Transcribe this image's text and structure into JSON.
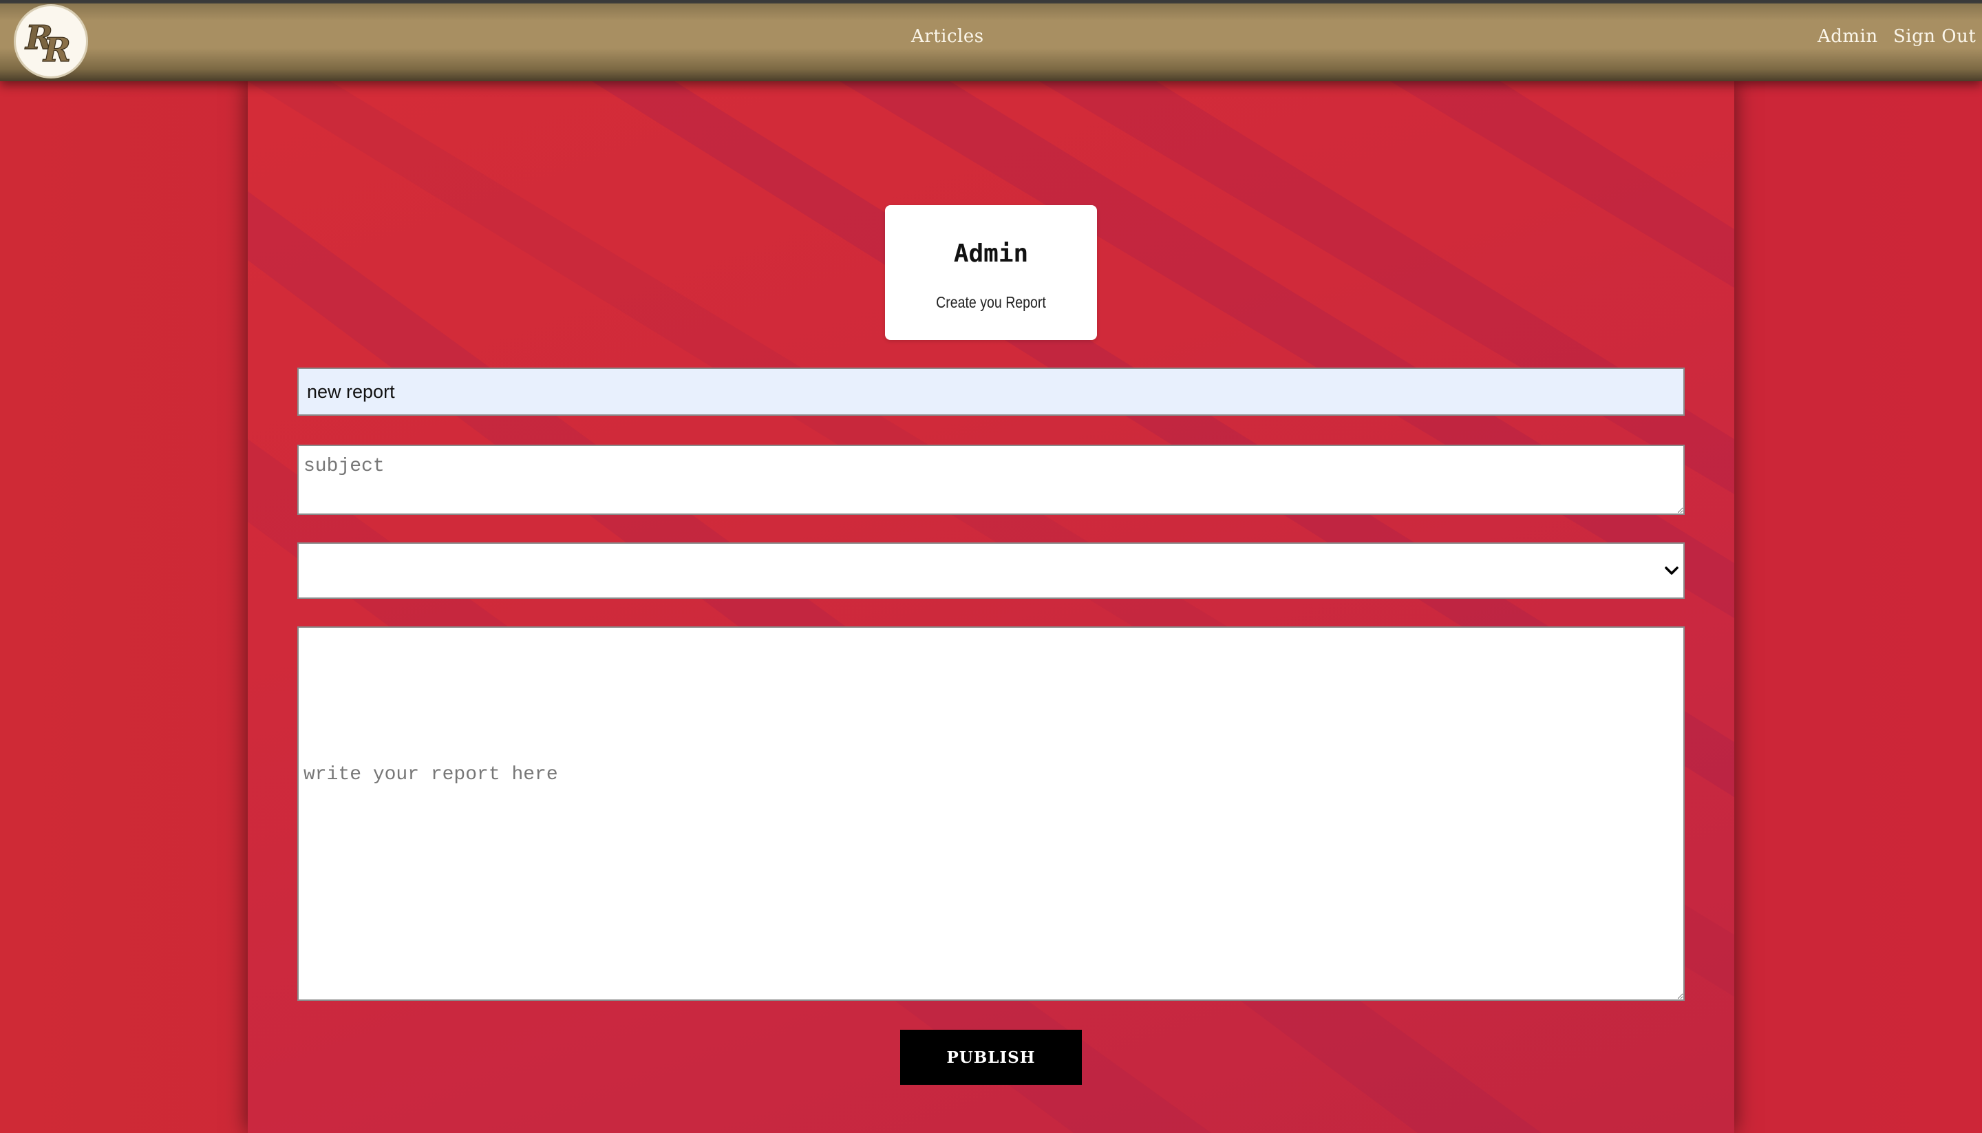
{
  "nav": {
    "logo_alt": "RR",
    "articles_label": "Articles",
    "admin_label": "Admin",
    "signout_label": "Sign Out"
  },
  "header": {
    "title": "Admin",
    "subtitle": "Create you Report"
  },
  "form": {
    "title_value": "new report",
    "subject_placeholder": "subject",
    "category_selected": "",
    "report_placeholder": "write your report here",
    "publish_label": "PUBLISH"
  },
  "colors": {
    "navbar": "#a88f62",
    "background": "#c9283a",
    "button": "#000000"
  }
}
